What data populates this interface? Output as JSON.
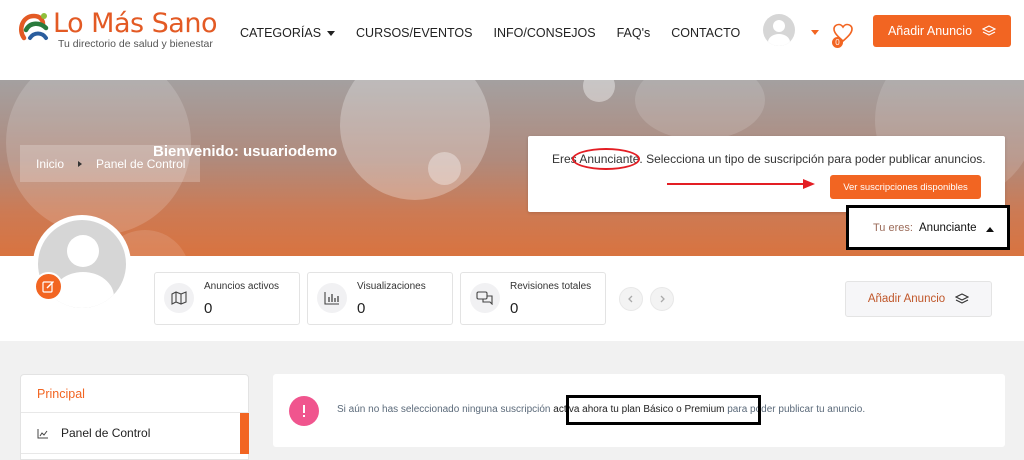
{
  "header": {
    "logo_title": "Lo Más Sano",
    "logo_subtitle": "Tu directorio de salud y bienestar",
    "nav": [
      {
        "label": "CATEGORÍAS",
        "has_dropdown": true
      },
      {
        "label": "CURSOS/EVENTOS",
        "has_dropdown": false
      },
      {
        "label": "INFO/CONSEJOS",
        "has_dropdown": false
      },
      {
        "label": "FAQ's",
        "has_dropdown": false
      },
      {
        "label": "CONTACTO",
        "has_dropdown": false
      }
    ],
    "favorites_count": "0",
    "add_button_label": "Añadir Anuncio",
    "accent_color": "#f26522"
  },
  "banner": {
    "breadcrumb": [
      "Inicio",
      "Panel de Control"
    ],
    "welcome": "Bienvenido: usuariodemo",
    "notice": {
      "prefix": "Eres ",
      "role_word": "Anunciante",
      "suffix": ". Selecciona un tipo de suscripción para poder publicar anuncios.",
      "button_label": "Ver suscripciones disponibles"
    },
    "role_select": {
      "label": "Tu eres:",
      "value": "Anunciante"
    }
  },
  "stats": [
    {
      "label": "Anuncios activos",
      "value": "0",
      "icon": "map-icon"
    },
    {
      "label": "Visualizaciones",
      "value": "0",
      "icon": "bar-chart-icon"
    },
    {
      "label": "Revisiones totales",
      "value": "0",
      "icon": "chat-icon"
    }
  ],
  "add_button_secondary": "Añadir Anuncio",
  "sidebar": {
    "section_title": "Principal",
    "items": [
      {
        "label": "Panel de Control",
        "icon": "trend-icon",
        "active": true
      }
    ]
  },
  "info": {
    "prefix": "Si aún no has seleccionado ninguna suscripción ",
    "highlight": "activa ahora tu plan Básico o Premium",
    "suffix": " para poder publicar tu anuncio."
  }
}
